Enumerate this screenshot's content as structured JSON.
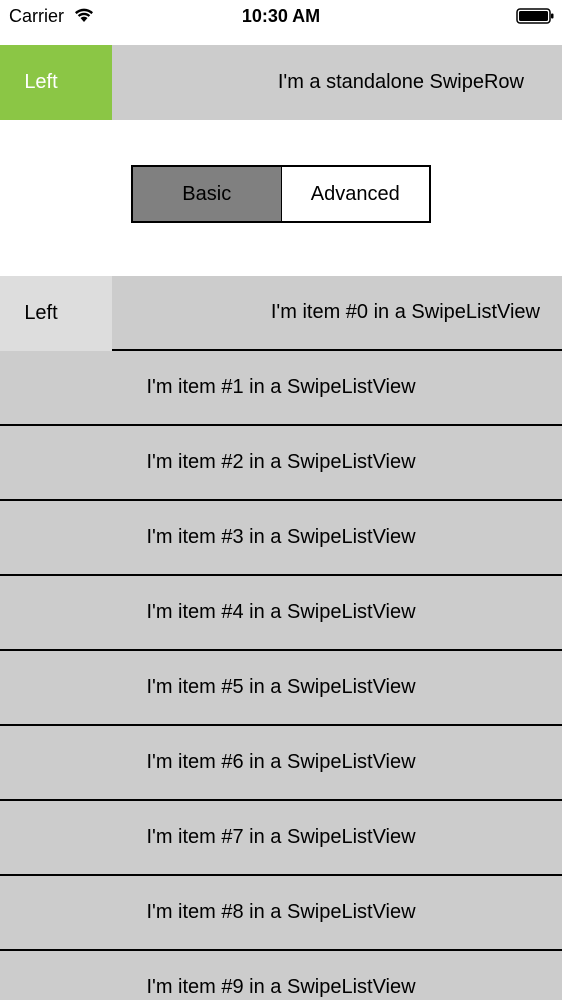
{
  "status_bar": {
    "carrier": "Carrier",
    "time": "10:30 AM",
    "wifi_icon": "wifi-icon",
    "battery_icon": "battery-icon"
  },
  "standalone_row": {
    "left_action_label": "Left",
    "label": "I'm a standalone SwipeRow",
    "left_action_color": "#8bc645",
    "row_color": "#cccccc"
  },
  "segmented_control": {
    "options": [
      "Basic",
      "Advanced"
    ],
    "selected": "Basic",
    "active_color": "#808080"
  },
  "swipe_list": {
    "hidden_left_label": "Left",
    "hidden_left_color": "#dddddd",
    "row_color": "#cccccc",
    "items": [
      "I'm item #0 in a SwipeListView",
      "I'm item #1 in a SwipeListView",
      "I'm item #2 in a SwipeListView",
      "I'm item #3 in a SwipeListView",
      "I'm item #4 in a SwipeListView",
      "I'm item #5 in a SwipeListView",
      "I'm item #6 in a SwipeListView",
      "I'm item #7 in a SwipeListView",
      "I'm item #8 in a SwipeListView",
      "I'm item #9 in a SwipeListView"
    ]
  }
}
